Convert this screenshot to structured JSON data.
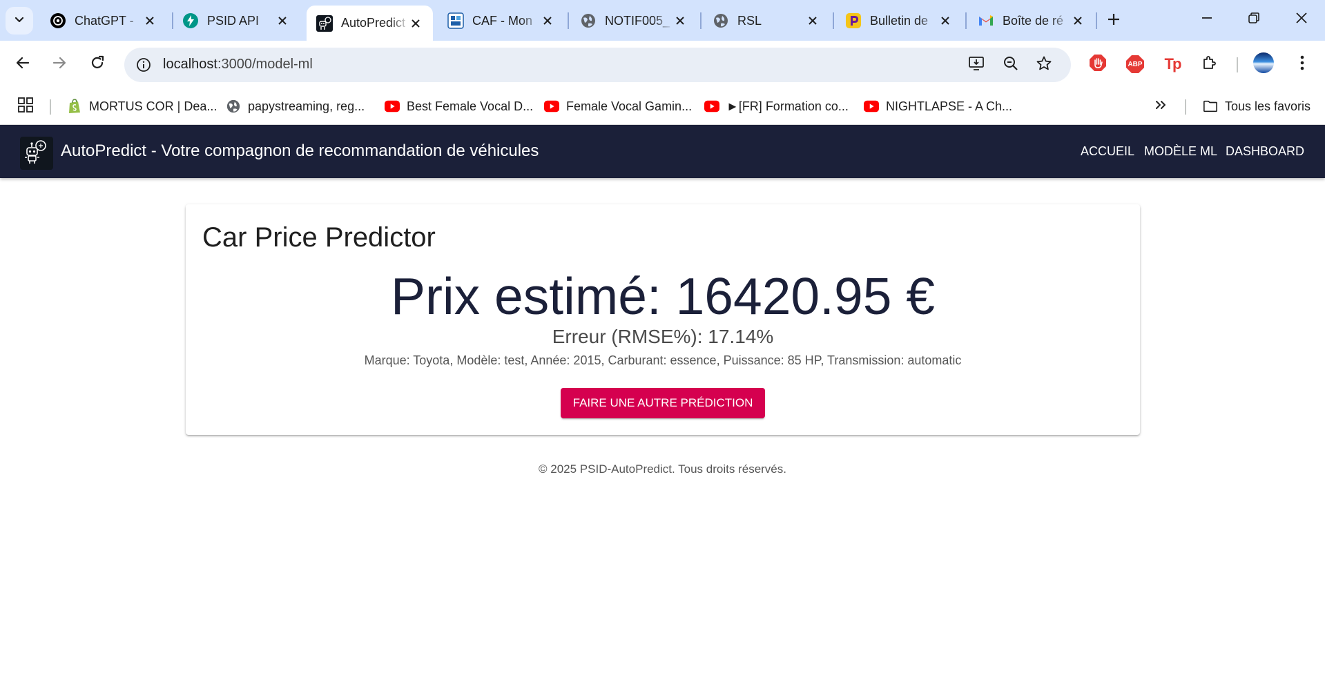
{
  "browser": {
    "tabs": [
      {
        "title": "ChatGPT -",
        "icon": "chatgpt-icon",
        "active": false
      },
      {
        "title": "PSID API",
        "icon": "fastapi-icon",
        "active": false
      },
      {
        "title": "AutoPredict",
        "icon": "autopredict-robot-icon",
        "active": true
      },
      {
        "title": "CAF - Mon",
        "icon": "caf-icon",
        "active": false
      },
      {
        "title": "NOTIF005_",
        "icon": "globe-icon",
        "active": false
      },
      {
        "title": "RSL",
        "icon": "globe-icon",
        "active": false
      },
      {
        "title": "Bulletin de",
        "icon": "pronote-icon",
        "active": false
      },
      {
        "title": "Boîte de ré",
        "icon": "gmail-icon",
        "active": false
      }
    ],
    "url_host": "localhost",
    "url_path": ":3000/model-ml",
    "bookmarks": [
      {
        "label": "MORTUS COR | Dea...",
        "icon": "shopify-icon"
      },
      {
        "label": "papystreaming, reg...",
        "icon": "globe-icon"
      },
      {
        "label": "Best Female Vocal D...",
        "icon": "youtube-icon"
      },
      {
        "label": "Female Vocal Gamin...",
        "icon": "youtube-icon"
      },
      {
        "label": "►[FR] Formation co...",
        "icon": "youtube-icon"
      },
      {
        "label": "NIGHTLAPSE - A Ch...",
        "icon": "youtube-icon"
      }
    ],
    "all_bookmarks_label": "Tous les favoris",
    "ext_abp_label": "ABP",
    "ext_tp_label": "Tp"
  },
  "app": {
    "title": "AutoPredict - Votre compagnon de recommandation de véhicules",
    "nav": [
      "Accueil",
      "Modèle ML",
      "Dashboard"
    ]
  },
  "card": {
    "title": "Car Price Predictor",
    "price_text": "Prix estimé: 16420.95 €",
    "rmse_text": "Erreur (RMSE%): 17.14%",
    "details_text": "Marque: Toyota, Modèle: test, Année: 2015, Carburant: essence, Puissance: 85 HP, Transmission: automatic",
    "button_label": "Faire une autre prédiction"
  },
  "footer": "© 2025 PSID-AutoPredict. Tous droits réservés.",
  "colors": {
    "appbar": "#1b2039",
    "accent_button": "#d5004f",
    "browser_frame": "#d3e3fd"
  }
}
